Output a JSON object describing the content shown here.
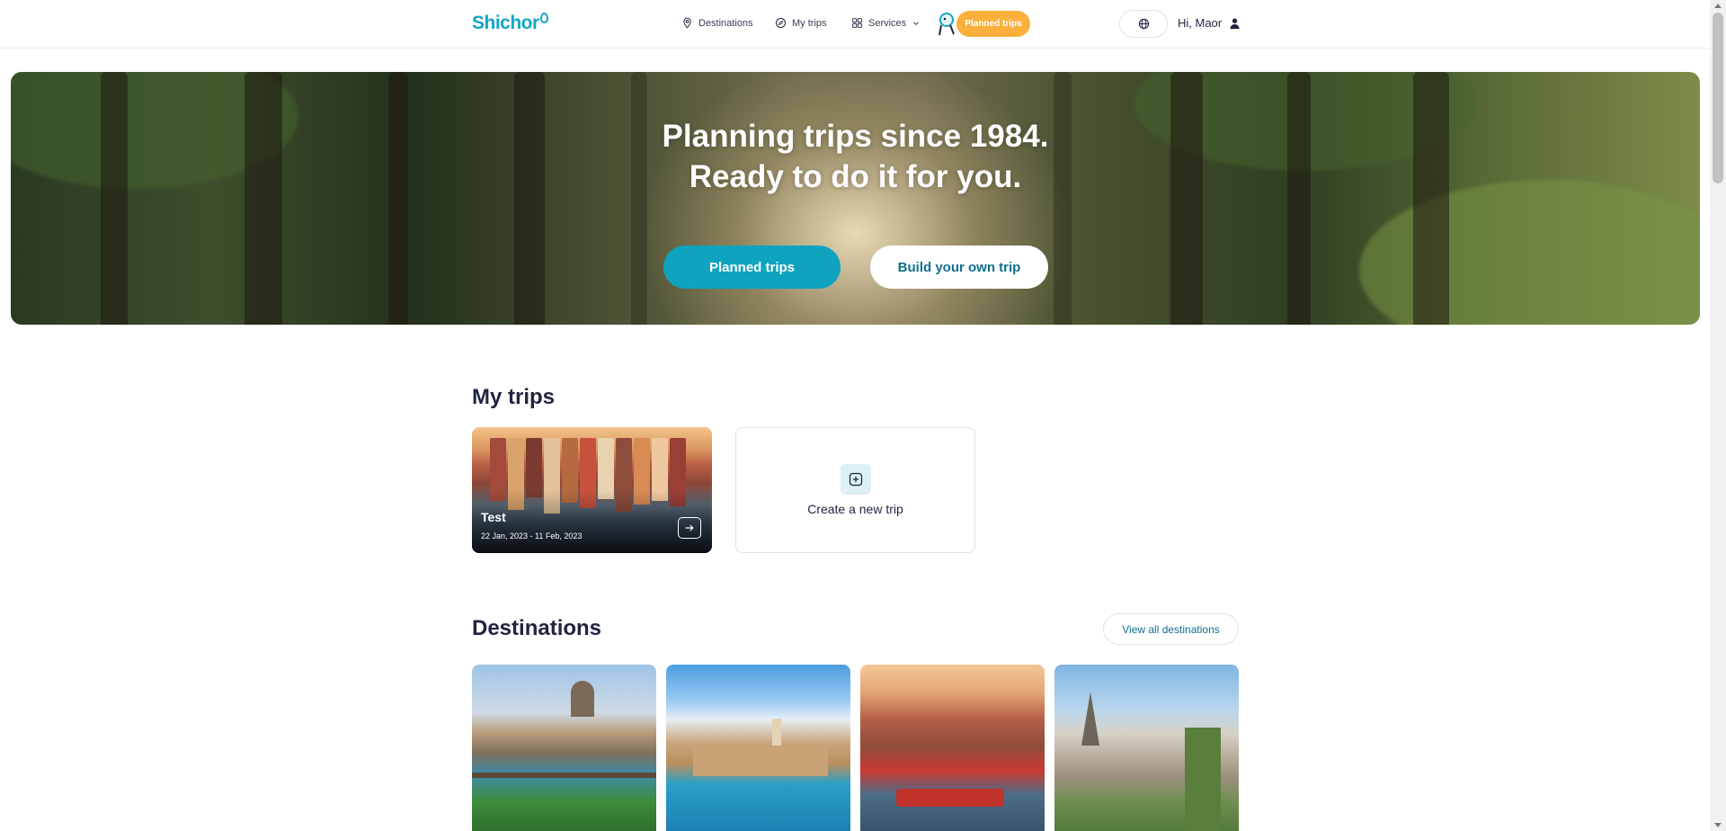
{
  "header": {
    "logo": "Shichor",
    "nav": {
      "destinations": "Destinations",
      "my_trips": "My trips",
      "services": "Services"
    },
    "planned_trips_pill": "Planned trips",
    "greeting": "Hi, Maor",
    "icons": [
      "location-pin-icon",
      "compass-icon",
      "grid-icon",
      "chevron-down-icon",
      "globe-icon",
      "user-icon"
    ]
  },
  "hero": {
    "title_line1": "Planning trips since 1984.",
    "title_line2": "Ready to do it for you.",
    "primary_button": "Planned trips",
    "secondary_button": "Build your own trip"
  },
  "my_trips": {
    "title": "My trips",
    "trips": [
      {
        "name": "Test",
        "dates": "22 Jan, 2023 - 11 Feb, 2023"
      }
    ],
    "create_label": "Create a new trip"
  },
  "destinations": {
    "title": "Destinations",
    "view_all": "View all destinations"
  },
  "colors": {
    "brand": "#14a6c4",
    "primary_button": "#0fa3bf",
    "accent_orange": "#fbb03b",
    "text_dark": "#1f2440"
  }
}
